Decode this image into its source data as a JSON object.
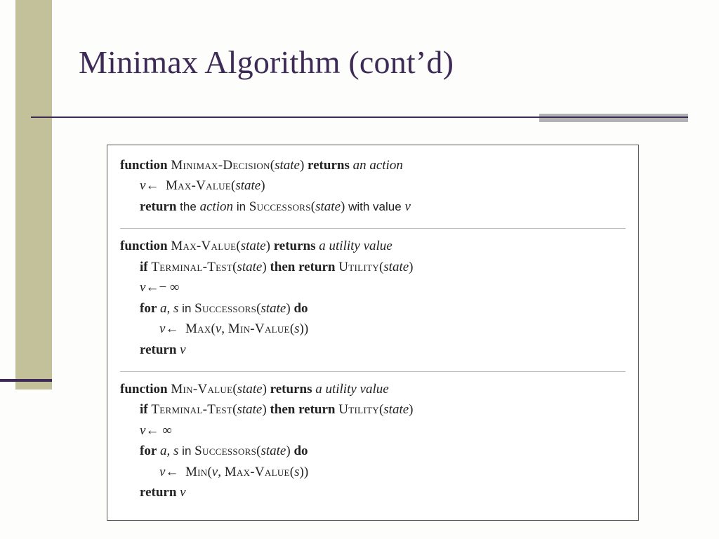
{
  "title": "Minimax Algorithm (cont’d)",
  "f1": {
    "kw_function": "function",
    "name": "Minimax-Decision",
    "arg": "state",
    "kw_returns": "returns",
    "ret": "an action",
    "l2_v": "v",
    "l2_arrow": "←",
    "l2_call": "Max-Value",
    "l2_arg": "state",
    "l3_kw": "return",
    "l3_the": "the",
    "l3_action": "action",
    "l3_in": "in",
    "l3_succ": "Successors",
    "l3_arg": "state",
    "l3_with": "with value",
    "l3_v": "v"
  },
  "f2": {
    "kw_function": "function",
    "name": "Max-Value",
    "arg": "state",
    "kw_returns": "returns",
    "ret": "a utility value",
    "l2_if": "if",
    "l2_test": "Terminal-Test",
    "l2_targ": "state",
    "l2_then": "then return",
    "l2_util": "Utility",
    "l2_uarg": "state",
    "l3_v": "v",
    "l3_arrow": "←",
    "l3_neg_inf": "− ∞",
    "l4_for": "for",
    "l4_as": "a, s",
    "l4_in": "in",
    "l4_succ": "Successors",
    "l4_sarg": "state",
    "l4_do": "do",
    "l5_v": "v",
    "l5_arrow": "←",
    "l5_max": "Max",
    "l5_varg": "v",
    "l5_comma": ",",
    "l5_minv": "Min-Value",
    "l5_s": "s",
    "l6_kw": "return",
    "l6_v": "v"
  },
  "f3": {
    "kw_function": "function",
    "name": "Min-Value",
    "arg": "state",
    "kw_returns": "returns",
    "ret": "a utility value",
    "l2_if": "if",
    "l2_test": "Terminal-Test",
    "l2_targ": "state",
    "l2_then": "then return",
    "l2_util": "Utility",
    "l2_uarg": "state",
    "l3_v": "v",
    "l3_arrow": "←",
    "l3_inf": "∞",
    "l4_for": "for",
    "l4_as": "a, s",
    "l4_in": "in",
    "l4_succ": "Successors",
    "l4_sarg": "state",
    "l4_do": "do",
    "l5_v": "v",
    "l5_arrow": "←",
    "l5_min": "Min",
    "l5_varg": "v",
    "l5_comma": ",",
    "l5_maxv": "Max-Value",
    "l5_s": "s",
    "l6_kw": "return",
    "l6_v": "v"
  }
}
